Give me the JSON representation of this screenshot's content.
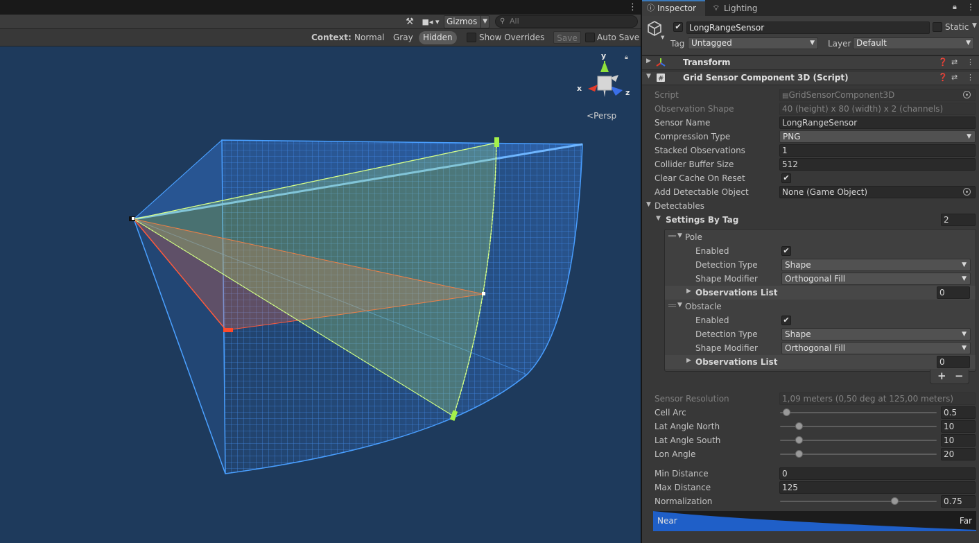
{
  "scene": {
    "gizmos_label": "Gizmos",
    "search_placeholder": "All",
    "context_label": "Context:",
    "context_options": [
      "Normal",
      "Gray",
      "Hidden"
    ],
    "context_active": "Hidden",
    "show_overrides": "Show Overrides",
    "save_label": "Save",
    "auto_save": "Auto Save",
    "persp_label": "Persp",
    "axis_x": "x",
    "axis_y": "y",
    "axis_z": "z"
  },
  "inspector": {
    "tabs": {
      "inspector": "Inspector",
      "lighting": "Lighting"
    },
    "object": {
      "name": "LongRangeSensor",
      "active": true,
      "static_label": "Static",
      "tag_label": "Tag",
      "tag_value": "Untagged",
      "layer_label": "Layer",
      "layer_value": "Default"
    },
    "components": {
      "transform": "Transform",
      "grid_sensor": "Grid Sensor Component 3D (Script)"
    },
    "props": {
      "script": {
        "label": "Script",
        "value": "GridSensorComponent3D"
      },
      "obs_shape": {
        "label": "Observation Shape",
        "value": "40 (height) x 80 (width) x 2 (channels)"
      },
      "sensor_name": {
        "label": "Sensor Name",
        "value": "LongRangeSensor"
      },
      "compression": {
        "label": "Compression Type",
        "value": "PNG"
      },
      "stacked": {
        "label": "Stacked Observations",
        "value": "1"
      },
      "collider_buffer": {
        "label": "Collider Buffer Size",
        "value": "512"
      },
      "clear_cache": {
        "label": "Clear Cache On Reset",
        "checked": true
      },
      "add_detectable": {
        "label": "Add Detectable Object",
        "value": "None (Game Object)"
      },
      "detectables": "Detectables",
      "settings_by_tag": {
        "label": "Settings By Tag",
        "value": "2"
      }
    },
    "tags": [
      {
        "name": "Pole",
        "enabled_label": "Enabled",
        "enabled": true,
        "detection_label": "Detection Type",
        "detection_value": "Shape",
        "modifier_label": "Shape Modifier",
        "modifier_value": "Orthogonal Fill",
        "obs_label": "Observations List",
        "obs_value": "0"
      },
      {
        "name": "Obstacle",
        "enabled_label": "Enabled",
        "enabled": true,
        "detection_label": "Detection Type",
        "detection_value": "Shape",
        "modifier_label": "Shape Modifier",
        "modifier_value": "Orthogonal Fill",
        "obs_label": "Observations List",
        "obs_value": "0"
      }
    ],
    "list_buttons": {
      "add": "+",
      "remove": "−"
    },
    "resolution": {
      "label": "Sensor Resolution",
      "value": "1,09 meters (0,50 deg at 125,00 meters)"
    },
    "sliders": {
      "cell_arc": {
        "label": "Cell Arc",
        "value": "0.5",
        "fraction": 0.04
      },
      "lat_north": {
        "label": "Lat Angle North",
        "value": "10",
        "fraction": 0.12
      },
      "lat_south": {
        "label": "Lat Angle South",
        "value": "10",
        "fraction": 0.12
      },
      "lon_angle": {
        "label": "Lon Angle",
        "value": "20",
        "fraction": 0.12
      },
      "normalization": {
        "label": "Normalization",
        "value": "0.75",
        "fraction": 0.73
      }
    },
    "min_distance": {
      "label": "Min Distance",
      "value": "0"
    },
    "max_distance": {
      "label": "Max Distance",
      "value": "125"
    },
    "gradient": {
      "near": "Near",
      "far": "Far"
    }
  },
  "colors": {
    "scene_bg": "#1e3a5c",
    "grid_blue": "#3f8fff",
    "wedge_green": "#b9f06a",
    "wedge_red": "#ff5a3c",
    "accent": "#3a79bb"
  }
}
